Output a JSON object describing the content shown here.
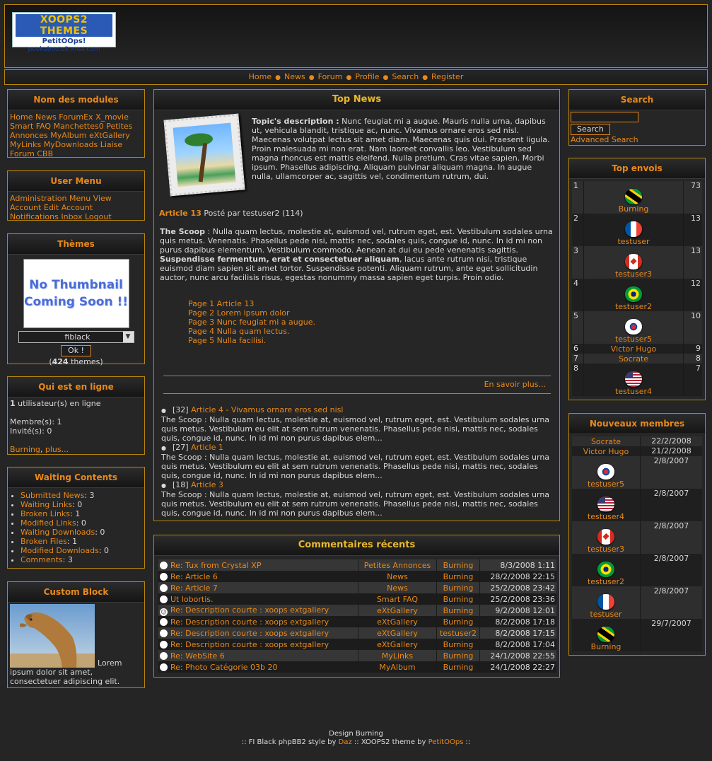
{
  "logo": {
    "line1": "XOOPS2 THEMES",
    "line2": "PetitOOps!",
    "line3": "peekaboo.s8.xrea.com"
  },
  "nav": [
    "Home",
    "News",
    "Forum",
    "Profile",
    "Search",
    "Register"
  ],
  "modules": {
    "title": "Nom des modules",
    "links": [
      "Home",
      "News",
      "ForumEx",
      "X_movie",
      "Smart FAQ",
      "Manchettes0",
      "Petites Annonces",
      "MyAlbum",
      "eXtGallery",
      "MyLinks",
      "MyDownloads",
      "Liaise",
      "Forum CBB"
    ]
  },
  "usermenu": {
    "title": "User Menu",
    "links": [
      "Administration Menu",
      "View Account",
      "Edit Account",
      "Notifications",
      "Inbox",
      "Logout"
    ]
  },
  "themes": {
    "title": "Thèmes",
    "thumb_line1": "No Thumbnail",
    "thumb_line2": "Coming Soon !!",
    "selected": "fiblack",
    "ok": "Ok !",
    "count": "424",
    "count_suffix": " themes)",
    "count_prefix": "("
  },
  "online": {
    "title": "Qui est en ligne",
    "count": "1",
    "count_text": " utilisateur(s) en ligne",
    "members": "Membre(s): 1",
    "guests": "Invité(s): 0",
    "user": "Burning",
    "more": "plus..."
  },
  "waiting": {
    "title": "Waiting Contents",
    "items": [
      {
        "label": "Submitted News",
        "value": ": 3"
      },
      {
        "label": "Waiting Links",
        "value": ": 0"
      },
      {
        "label": "Broken Links",
        "value": ": 1"
      },
      {
        "label": "Modified Links",
        "value": ": 0"
      },
      {
        "label": "Waiting Downloads",
        "value": ": 0"
      },
      {
        "label": "Broken Files",
        "value": ": 1"
      },
      {
        "label": "Modified Downloads",
        "value": ": 0"
      },
      {
        "label": "Comments",
        "value": ": 3"
      }
    ]
  },
  "custom": {
    "title": "Custom Block",
    "text": "Lorem ipsum dolor sit amet, consectetuer adipiscing elit."
  },
  "topnews": {
    "title": "Top News",
    "topic_label": "Topic's description :",
    "topic_text": "Nunc feugiat mi a augue. Mauris nulla urna, dapibus ut, vehicula blandit, tristique ac, nunc. Vivamus ornare eros sed nisl. Maecenas volutpat lectus sit amet diam. Maecenas quis dui. Praesent ligula. Proin malesuada mi non erat. Nam laoreet convallis leo. Vestibulum sed magna rhoncus est mattis eleifend. Nulla pretium. Cras vitae sapien. Morbi ipsum. Phasellus adipiscing. Aliquam pulvinar aliquam magna. In augue nulla, ullamcorper ac, sagittis vel, condimentum rutrum, dui.",
    "article_title": "Article 13",
    "posted_by": " Posté par testuser2 (114)",
    "scoop_label": "The Scoop",
    "scoop_text1": " : Nulla quam lectus, molestie at, euismod vel, rutrum eget, est. Vestibulum sodales urna quis metus. Venenatis. Phasellus pede nisi, mattis nec, sodales quis, congue id, nunc. In id mi non purus dapibus elementum. Vestibulum commodo. Aenean at dui eu pede venenatis sagittis. ",
    "scoop_bold": "Suspendisse fermentum, erat et consectetuer aliquam",
    "scoop_text2": ", lacus ante rutrum nisi, tristique euismod diam sapien sit amet tortor. Suspendisse potenti. Aliquam rutrum, ante eget sollicitudin auctor, nunc arcu facilisis risus, egestas nonummy massa sapien eget turpis. Proin odio.",
    "pages": [
      "Page 1 Article 13",
      "Page 2 Lorem ipsum dolor",
      "Page 3 Nunc feugiat mi a augue.",
      "Page 4 Nulla quam lectus.",
      "Page 5 Nulla facilisi."
    ],
    "more": "En savoir plus...",
    "list": [
      {
        "num": "[32]",
        "title": "Article 4 - Vivamus ornare eros sed nisl",
        "text": "The Scoop : Nulla quam lectus, molestie at, euismod vel, rutrum eget, est. Vestibulum sodales urna quis metus. Vestibulum eu elit at sem rutrum venenatis. Phasellus pede nisi, mattis nec, sodales quis, congue id, nunc. In id mi non purus dapibus elem..."
      },
      {
        "num": "[27]",
        "title": "Article 1",
        "text": "The Scoop : Nulla quam lectus, molestie at, euismod vel, rutrum eget, est. Vestibulum sodales urna quis metus. Vestibulum eu elit at sem rutrum venenatis. Phasellus pede nisi, mattis nec, sodales quis, congue id, nunc. In id mi non purus dapibus elem..."
      },
      {
        "num": "[18]",
        "title": "Article 3",
        "text": "The Scoop : Nulla quam lectus, molestie at, euismod vel, rutrum eget, est. Vestibulum sodales urna quis metus. Vestibulum eu elit at sem rutrum venenatis. Phasellus pede nisi, mattis nec, sodales quis, congue id, nunc. In id mi non purus dapibus elem..."
      }
    ]
  },
  "comments": {
    "title": "Commentaires récents",
    "rows": [
      {
        "title": "Re: Tux from Crystal XP",
        "module": "Petites Annonces",
        "user": "Burning",
        "date": "8/3/2008 1:11",
        "icon": "circle"
      },
      {
        "title": "Re: Article 6",
        "module": "News",
        "user": "Burning",
        "date": "28/2/2008 22:15",
        "icon": "circle"
      },
      {
        "title": "Re: Article 7",
        "module": "News",
        "user": "Burning",
        "date": "25/2/2008 23:42",
        "icon": "circle"
      },
      {
        "title": "Ut lobortis.",
        "module": "Smart FAQ",
        "user": "Burning",
        "date": "25/2/2008 23:36",
        "icon": "circle"
      },
      {
        "title": "Re: Description courte : xoops extgallery",
        "module": "eXtGallery",
        "user": "Burning",
        "date": "9/2/2008 12:01",
        "icon": "smiley"
      },
      {
        "title": "Re: Description courte : xoops extgallery",
        "module": "eXtGallery",
        "user": "Burning",
        "date": "8/2/2008 17:18",
        "icon": "circle"
      },
      {
        "title": "Re: Description courte : xoops extgallery",
        "module": "eXtGallery",
        "user": "testuser2",
        "date": "8/2/2008 17:15",
        "icon": "circle"
      },
      {
        "title": "Re: Description courte : xoops extgallery",
        "module": "eXtGallery",
        "user": "Burning",
        "date": "8/2/2008 17:04",
        "icon": "circle"
      },
      {
        "title": "Re: WebSite 6",
        "module": "MyLinks",
        "user": "Burning",
        "date": "24/1/2008 22:55",
        "icon": "circle"
      },
      {
        "title": "Re: Photo Catégorie 03b 20",
        "module": "MyAlbum",
        "user": "Burning",
        "date": "24/1/2008 22:27",
        "icon": "circle"
      }
    ]
  },
  "search": {
    "title": "Search",
    "button": "Search",
    "advanced": "Advanced Search",
    "value": ""
  },
  "topposters": {
    "title": "Top envois",
    "rows": [
      {
        "rank": "1",
        "name": "Burning",
        "posts": "73",
        "flag": "jamaica"
      },
      {
        "rank": "2",
        "name": "testuser",
        "posts": "13",
        "flag": "france"
      },
      {
        "rank": "3",
        "name": "testuser3",
        "posts": "13",
        "flag": "canada"
      },
      {
        "rank": "4",
        "name": "testuser2",
        "posts": "12",
        "flag": "brazil"
      },
      {
        "rank": "5",
        "name": "testuser5",
        "posts": "10",
        "flag": "korea"
      },
      {
        "rank": "6",
        "name": "Victor Hugo",
        "posts": "9",
        "flag": ""
      },
      {
        "rank": "7",
        "name": "Socrate",
        "posts": "8",
        "flag": ""
      },
      {
        "rank": "8",
        "name": "testuser4",
        "posts": "7",
        "flag": "usa"
      }
    ]
  },
  "newmembers": {
    "title": "Nouveaux membres",
    "rows": [
      {
        "name": "Socrate",
        "date": "22/2/2008",
        "flag": ""
      },
      {
        "name": "Victor Hugo",
        "date": "21/2/2008",
        "flag": ""
      },
      {
        "name": "testuser5",
        "date": "2/8/2007",
        "flag": "korea"
      },
      {
        "name": "testuser4",
        "date": "2/8/2007",
        "flag": "usa"
      },
      {
        "name": "testuser3",
        "date": "2/8/2007",
        "flag": "canada"
      },
      {
        "name": "testuser2",
        "date": "2/8/2007",
        "flag": "brazil"
      },
      {
        "name": "testuser",
        "date": "2/8/2007",
        "flag": "france"
      },
      {
        "name": "Burning",
        "date": "29/7/2007",
        "flag": "jamaica"
      }
    ]
  },
  "footer": {
    "line1": "Design Burning",
    "prefix": ":: FI Black phpBB2 style by ",
    "author1": "Daz",
    "middle": " :: XOOPS2 theme by ",
    "author2": "PetitOOps",
    "suffix": " ::"
  },
  "colors": {
    "accent": "#e8891a",
    "title": "#e8b82a",
    "border": "#b8860b",
    "bg": "#252525"
  }
}
